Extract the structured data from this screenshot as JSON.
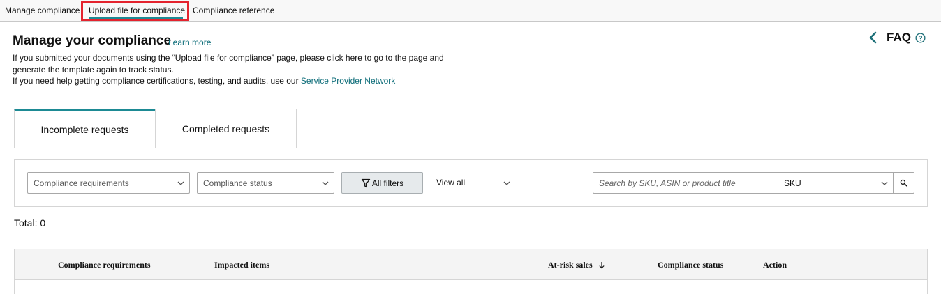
{
  "topnav": {
    "tabs": [
      "Manage compliance",
      "Upload file for compliance",
      "Compliance reference"
    ],
    "active_index": 1
  },
  "header": {
    "title": "Manage your compliance",
    "learn_more": "Learn more",
    "line1": "If you submitted your documents using the “Upload file for compliance” page, please click here to go to the page and",
    "line2": "generate the template again to track status.",
    "line3_prefix": "If you need help getting compliance certifications, testing, and audits, use our ",
    "line3_link": "Service Provider Network",
    "faq_label": "FAQ"
  },
  "request_tabs": {
    "incomplete": "Incomplete requests",
    "completed": "Completed requests"
  },
  "filters": {
    "requirements_select": "Compliance requirements",
    "status_select": "Compliance status",
    "all_filters": "All filters",
    "view_all": "View all",
    "search_placeholder": "Search by SKU, ASIN or product title",
    "search_field_select": "SKU"
  },
  "total_label": "Total: 0",
  "table": {
    "columns": [
      "Compliance requirements",
      "Impacted items",
      "At-risk sales",
      "Compliance status",
      "Action"
    ]
  },
  "colors": {
    "accent_teal": "#1d8a94",
    "link": "#0d6d79",
    "highlight_red": "#e4232e"
  },
  "icons": [
    "chevron-left-icon",
    "help-circle-icon",
    "chevron-down-icon",
    "filter-icon",
    "search-icon",
    "sort-down-arrow-icon"
  ]
}
